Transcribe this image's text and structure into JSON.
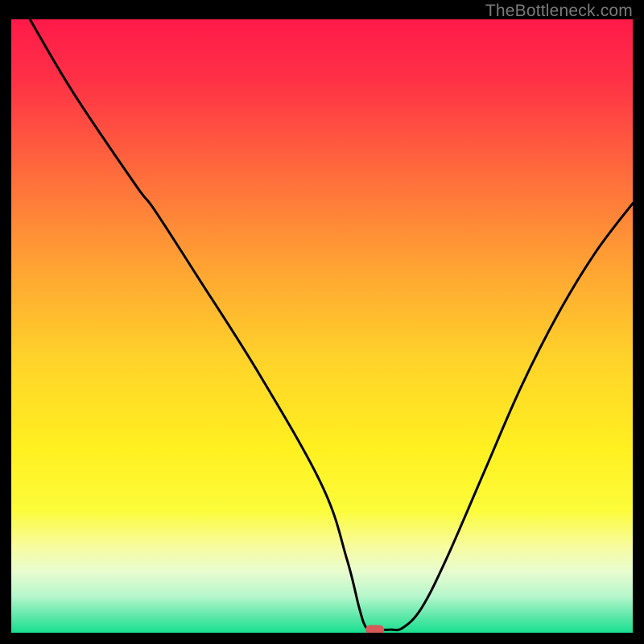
{
  "watermark": "TheBottleneck.com",
  "chart_data": {
    "type": "line",
    "title": "",
    "xlabel": "",
    "ylabel": "",
    "xlim": [
      0,
      100
    ],
    "ylim": [
      0,
      100
    ],
    "gradient_stops": [
      {
        "offset": 0.0,
        "color": "#ff1a49"
      },
      {
        "offset": 0.1,
        "color": "#ff3146"
      },
      {
        "offset": 0.25,
        "color": "#ff6b3c"
      },
      {
        "offset": 0.4,
        "color": "#ffa233"
      },
      {
        "offset": 0.55,
        "color": "#ffd22a"
      },
      {
        "offset": 0.7,
        "color": "#fff020"
      },
      {
        "offset": 0.8,
        "color": "#fcfc3a"
      },
      {
        "offset": 0.86,
        "color": "#f7fca0"
      },
      {
        "offset": 0.9,
        "color": "#e8fccf"
      },
      {
        "offset": 0.94,
        "color": "#b7f7cc"
      },
      {
        "offset": 0.97,
        "color": "#66e9ad"
      },
      {
        "offset": 1.0,
        "color": "#18df8f"
      }
    ],
    "series": [
      {
        "name": "bottleneck-curve",
        "x": [
          3,
          10,
          20,
          23,
          30,
          40,
          50,
          54,
          56,
          57,
          58,
          59,
          61,
          63,
          66,
          70,
          76,
          82,
          88,
          94,
          100
        ],
        "y": [
          100,
          88,
          73,
          69,
          58,
          42,
          24,
          12,
          4,
          1,
          0.5,
          0.5,
          0.5,
          0.8,
          4,
          12,
          26,
          40,
          52,
          62,
          70
        ]
      }
    ],
    "marker": {
      "name": "optimal-point",
      "x": 58.5,
      "y": 0.5,
      "width": 3.0,
      "height": 1.5,
      "color": "#d65a5a"
    }
  }
}
